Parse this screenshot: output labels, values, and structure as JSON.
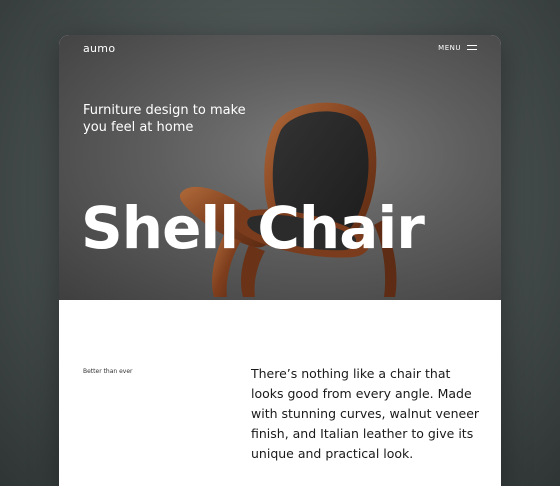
{
  "brand": {
    "logo_text": "aumo"
  },
  "nav": {
    "menu_label": "MENU"
  },
  "hero": {
    "tagline": "Furniture design to make you feel at home",
    "title": "Shell Chair"
  },
  "content": {
    "kicker": "Better than ever",
    "description": "There’s nothing like a chair that looks good from every angle. Made with stunning curves, walnut veneer finish, and Italian leather to give its unique and practical look."
  },
  "colors": {
    "page_background": "#4b5352",
    "hero_background": "#5d5d5d",
    "walnut": "#8a4a26",
    "leather": "#262626"
  }
}
